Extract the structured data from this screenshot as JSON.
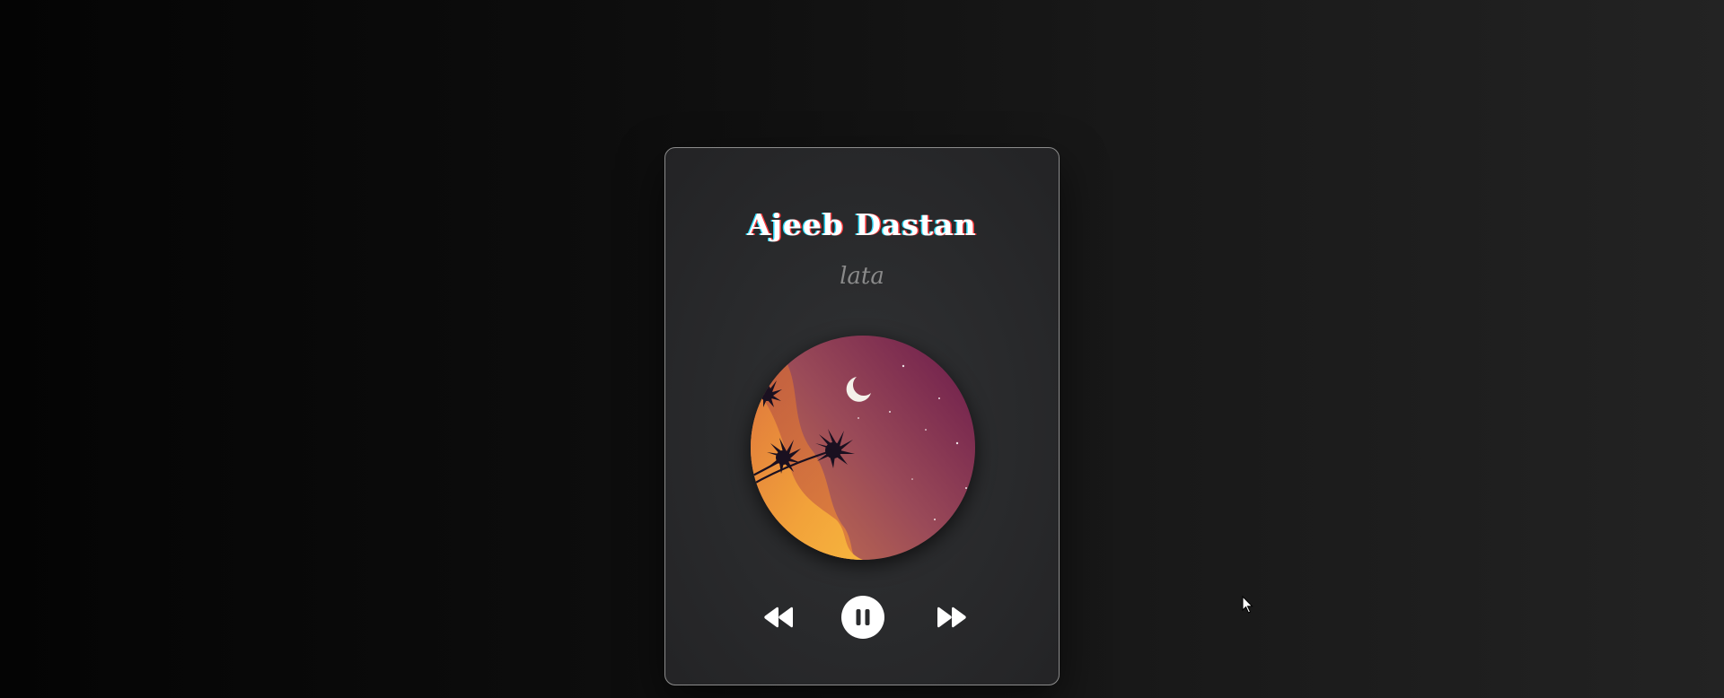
{
  "player": {
    "title": "Ajeeb Dastan",
    "artist": "lata",
    "artwork": "night-sky-palm-trees-moon",
    "state": "playing"
  },
  "controls": {
    "previous_icon": "rewind-icon",
    "play_pause_icon": "pause-icon",
    "next_icon": "fast-forward-icon"
  },
  "colors": {
    "title_text": "#ffffff",
    "artist_text": "#8a8a8a",
    "card_border": "#8c8c8c",
    "sky_top": "#6e1e4c",
    "sky_bottom": "#c9744e",
    "dunes": "#f0a83a"
  }
}
